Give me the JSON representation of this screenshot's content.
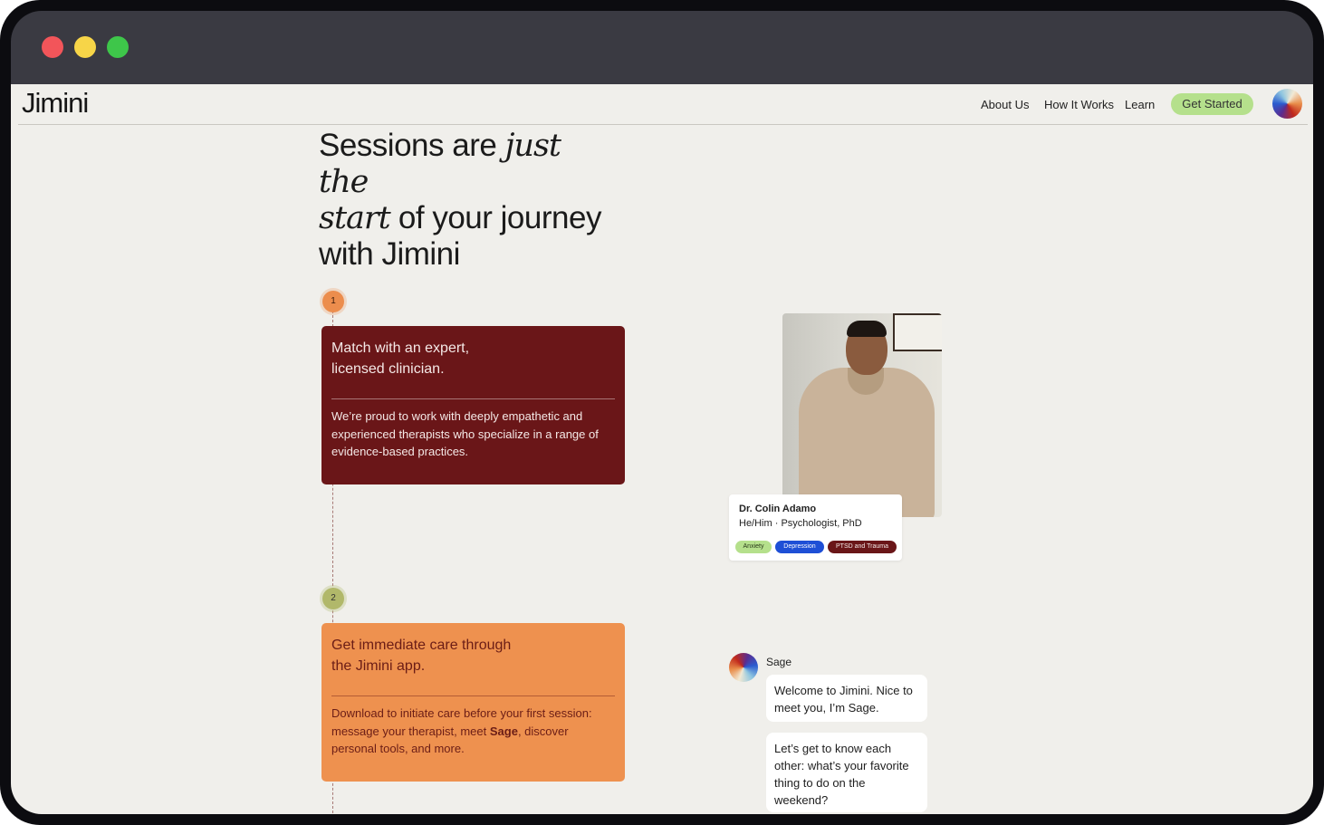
{
  "nav": {
    "logo": "Jimini",
    "links": [
      "About Us",
      "How It Works",
      "Learn"
    ],
    "cta": "Get Started",
    "avatar_icon": "gradient-orb-icon"
  },
  "hero": {
    "line1_a": "Sessions are ",
    "line1_b": "just the",
    "line2_a": "start",
    "line2_b": " of your journey",
    "line3": "with Jimini"
  },
  "steps": [
    {
      "number": "1",
      "title_line1": "Match with an expert,",
      "title_line2": "licensed clinician.",
      "body": "We’re proud to work with deeply empathetic and experienced therapists who specialize in a range of evidence-based practices."
    },
    {
      "number": "2",
      "title_line1": "Get immediate care through",
      "title_line2": "the Jimini app.",
      "body_a": "Download to initiate care before your first session: message your therapist, meet ",
      "body_bold": "Sage",
      "body_b": ", discover personal tools, and more."
    }
  ],
  "clinician": {
    "name": "Dr. Colin Adamo",
    "role": "He/Him · Psychologist, PhD",
    "tags": [
      "Anxiety",
      "Depression",
      "PTSD and Trauma"
    ],
    "tag_colors": [
      "#b5e08c",
      "#1e4fd6",
      "#6a1618"
    ]
  },
  "chat": {
    "sender": "Sage",
    "messages": [
      "Welcome to Jimini. Nice to meet you, I’m Sage.",
      "Let’s get to know each other: what’s your favorite thing to do on the weekend?"
    ]
  },
  "colors": {
    "page_bg": "#f0efeb",
    "card1_bg": "#6a1618",
    "card2_bg": "#ee914f",
    "cta_bg": "#b5e08c",
    "step1": "#ec8d4d",
    "step2": "#b1b86a"
  }
}
